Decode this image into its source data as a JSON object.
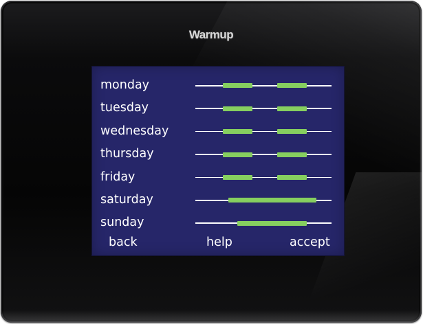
{
  "device": {
    "brand": "Warmup"
  },
  "schedule": {
    "days": [
      {
        "label": "monday",
        "periods": [
          [
            0.2,
            0.42
          ],
          [
            0.6,
            0.82
          ]
        ]
      },
      {
        "label": "tuesday",
        "periods": [
          [
            0.2,
            0.42
          ],
          [
            0.6,
            0.82
          ]
        ]
      },
      {
        "label": "wednesday",
        "periods": [
          [
            0.2,
            0.42
          ],
          [
            0.6,
            0.82
          ]
        ]
      },
      {
        "label": "thursday",
        "periods": [
          [
            0.2,
            0.42
          ],
          [
            0.6,
            0.82
          ]
        ]
      },
      {
        "label": "friday",
        "periods": [
          [
            0.2,
            0.42
          ],
          [
            0.6,
            0.82
          ]
        ]
      },
      {
        "label": "saturday",
        "periods": [
          [
            0.24,
            0.89
          ]
        ]
      },
      {
        "label": "sunday",
        "periods": [
          [
            0.31,
            0.82
          ]
        ]
      }
    ]
  },
  "buttons": {
    "back": "back",
    "help": "help",
    "accept": "accept"
  },
  "colors": {
    "screen_background": "#262669",
    "heating_period": "#86cf5f",
    "track": "#ffffff"
  }
}
